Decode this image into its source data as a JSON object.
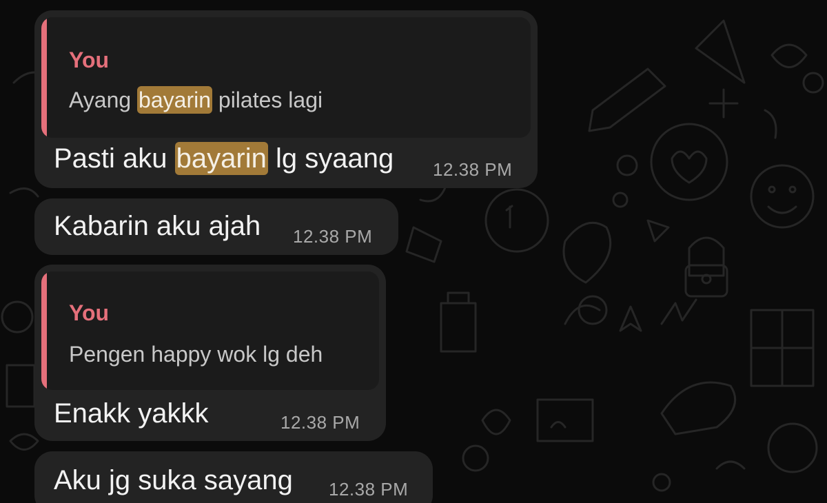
{
  "messages": [
    {
      "quote": {
        "author": "You",
        "text_before": "Ayang ",
        "highlight": "bayarin",
        "text_after": " pilates lagi"
      },
      "text_before": "Pasti aku ",
      "highlight": "bayarin",
      "text_after": " lg syaang",
      "time": "12.38 PM"
    },
    {
      "text": "Kabarin aku ajah",
      "time": "12.38 PM"
    },
    {
      "quote": {
        "author": "You",
        "text": "Pengen happy wok lg deh"
      },
      "text": "Enakk yakkk",
      "time": "12.38 PM"
    },
    {
      "text": "Aku jg suka sayang",
      "time": "12.38 PM"
    }
  ],
  "colors": {
    "background": "#0b0b0b",
    "bubble": "#232323",
    "quote_background": "#1b1b1b",
    "quote_accent": "#e5707b",
    "highlight": "#a27a38"
  },
  "icons": [
    "wallpaper-doodles"
  ]
}
